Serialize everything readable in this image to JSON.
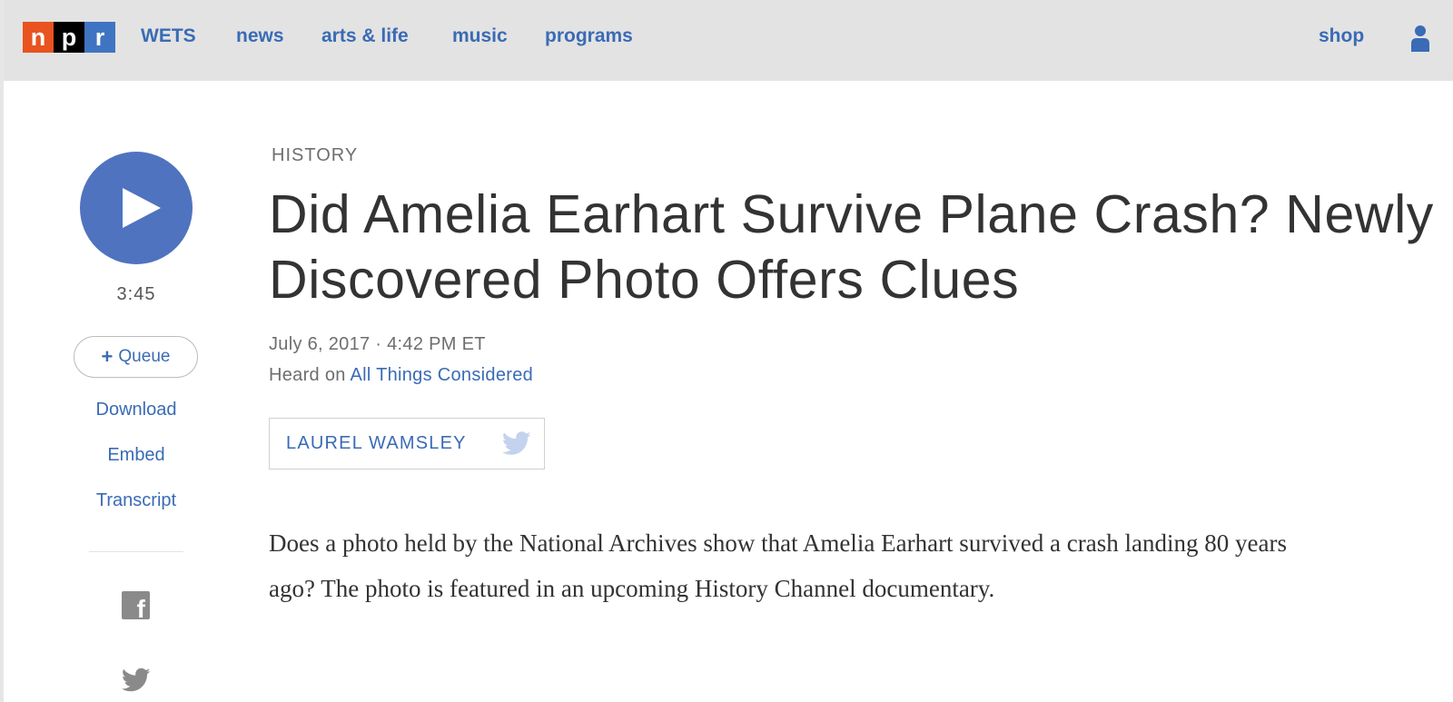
{
  "header": {
    "logo_letters": [
      "n",
      "p",
      "r"
    ],
    "nav": [
      "WETS",
      "news",
      "arts & life",
      "music",
      "programs"
    ],
    "shop_label": "shop",
    "colors": {
      "logo_n": "#e8531f",
      "logo_p": "#000000",
      "logo_r": "#3f74c3",
      "link": "#3a6bb5"
    }
  },
  "player": {
    "duration": "3:45",
    "queue_label": "Queue",
    "links": [
      "Download",
      "Embed",
      "Transcript"
    ],
    "share_icons": [
      "facebook-icon",
      "twitter-icon"
    ]
  },
  "article": {
    "section": "HISTORY",
    "headline": "Did Amelia Earhart Survive Plane Crash? Newly Discovered Photo Offers Clues",
    "dateline": "July 6, 2017 · 4:42 PM ET",
    "heard_prefix": "Heard on",
    "program": "All Things Considered",
    "author": "LAUREL WAMSLEY",
    "teaser": "Does a photo held by the National Archives show that Amelia Earhart survived a crash landing 80 years ago? The photo is featured in an upcoming History Channel documentary."
  }
}
